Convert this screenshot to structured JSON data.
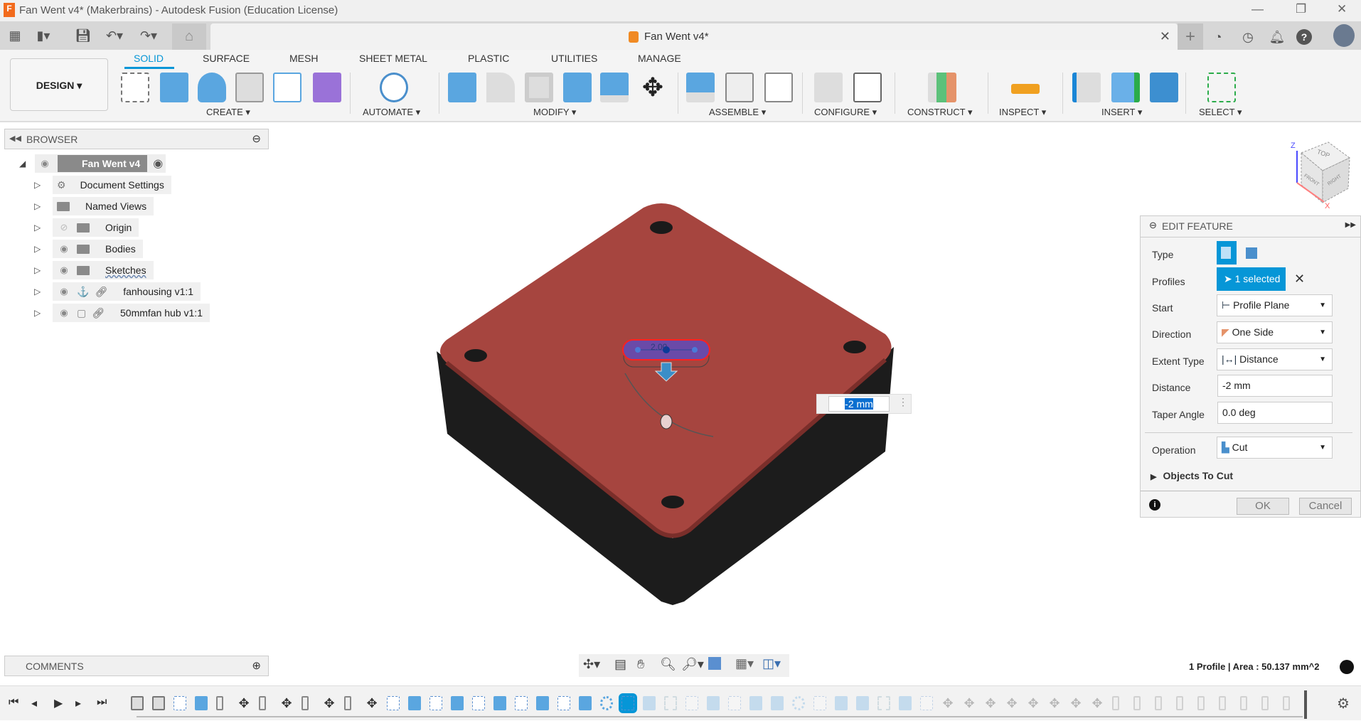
{
  "window": {
    "title": "Fan Went v4* (Makerbrains) - Autodesk Fusion (Education License)",
    "logo": "F"
  },
  "document_tab": {
    "name": "Fan Went v4*"
  },
  "workspace": {
    "label": "DESIGN ▾"
  },
  "ribbon_tabs": [
    "SOLID",
    "SURFACE",
    "MESH",
    "SHEET METAL",
    "PLASTIC",
    "UTILITIES",
    "MANAGE"
  ],
  "active_tab": "SOLID",
  "groups": [
    "CREATE ▾",
    "AUTOMATE ▾",
    "MODIFY ▾",
    "ASSEMBLE ▾",
    "CONFIGURE ▾",
    "CONSTRUCT ▾",
    "INSPECT ▾",
    "INSERT ▾",
    "SELECT ▾"
  ],
  "browser": {
    "title": "BROWSER",
    "root": "Fan Went v4",
    "items": [
      {
        "label": "Document Settings",
        "icon": "gear-icon"
      },
      {
        "label": "Named Views",
        "icon": "folder-icon"
      },
      {
        "label": "Origin",
        "icon": "folder-icon",
        "visibility": "hidden"
      },
      {
        "label": "Bodies",
        "icon": "folder-icon",
        "visibility": "visible"
      },
      {
        "label": "Sketches",
        "icon": "folder-icon",
        "visibility": "visible"
      },
      {
        "label": "fanhousing v1:1",
        "icon": "component-icon",
        "visibility": "visible"
      },
      {
        "label": "50mmfan hub v1:1",
        "icon": "component-icon",
        "visibility": "visible"
      }
    ]
  },
  "viewcube": {
    "top": "TOP",
    "front": "FRONT",
    "right": "RIGHT",
    "z": "Z",
    "x": "X"
  },
  "viewport": {
    "model_top_color": "#a6453f",
    "model_side_color": "#1c1c1c",
    "dimension_input": "-2 mm",
    "sketch_dim": "2.00"
  },
  "edit_feature": {
    "title": "EDIT FEATURE",
    "type_label": "Type",
    "profiles_label": "Profiles",
    "profiles_value": "1 selected",
    "start_label": "Start",
    "start_value": "Profile Plane",
    "direction_label": "Direction",
    "direction_value": "One Side",
    "extent_label": "Extent Type",
    "extent_value": "Distance",
    "distance_label": "Distance",
    "distance_value": "-2 mm",
    "taper_label": "Taper Angle",
    "taper_value": "0.0 deg",
    "operation_label": "Operation",
    "operation_value": "Cut",
    "objects_label": "Objects To Cut",
    "ok": "OK",
    "cancel": "Cancel",
    "accent": "#0696d7"
  },
  "comments": {
    "title": "COMMENTS"
  },
  "status": {
    "text": "1 Profile | Area : 50.137 mm^2"
  },
  "timeline": {
    "items": [
      "link",
      "link",
      "sketch",
      "extrude",
      "joint",
      "move",
      "joint",
      "move",
      "joint",
      "move",
      "joint",
      "move",
      "sketch",
      "extrude",
      "sketch",
      "extrude",
      "sketch",
      "extrude",
      "sketch",
      "extrude",
      "sketch",
      "extrude",
      "pattern",
      "sketch",
      "extrude",
      "construct",
      "sketch",
      "extrude",
      "sketch",
      "extrude",
      "extrude",
      "pattern",
      "sketch",
      "extrude",
      "extrude",
      "construct",
      "extrude",
      "sketch",
      "move",
      "move",
      "move",
      "move",
      "move",
      "move",
      "move",
      "move",
      "joint",
      "joint",
      "joint",
      "joint",
      "joint",
      "joint",
      "joint",
      "joint",
      "joint"
    ],
    "active_index": 23
  }
}
